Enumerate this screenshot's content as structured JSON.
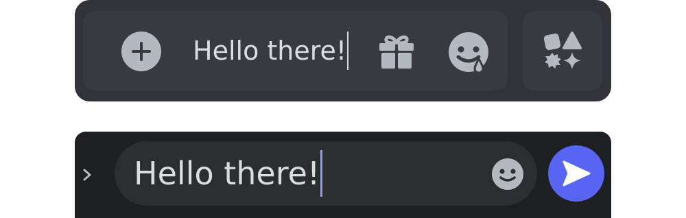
{
  "desktop": {
    "message": "Hello there!",
    "icons": {
      "attach": "plus-circle-icon",
      "gift": "gift-icon",
      "emoji": "drooling-emoji-icon",
      "apps": "apps-shapes-icon"
    }
  },
  "mobile": {
    "message": "Hello there!",
    "icons": {
      "expand": "chevron-right-icon",
      "emoji": "smile-emoji-icon",
      "send": "send-arrow-icon"
    }
  },
  "colors": {
    "accent": "#5865f2",
    "icon": "#b5bac1",
    "text": "#dbdee1",
    "mobile_caret": "#949cf7"
  }
}
